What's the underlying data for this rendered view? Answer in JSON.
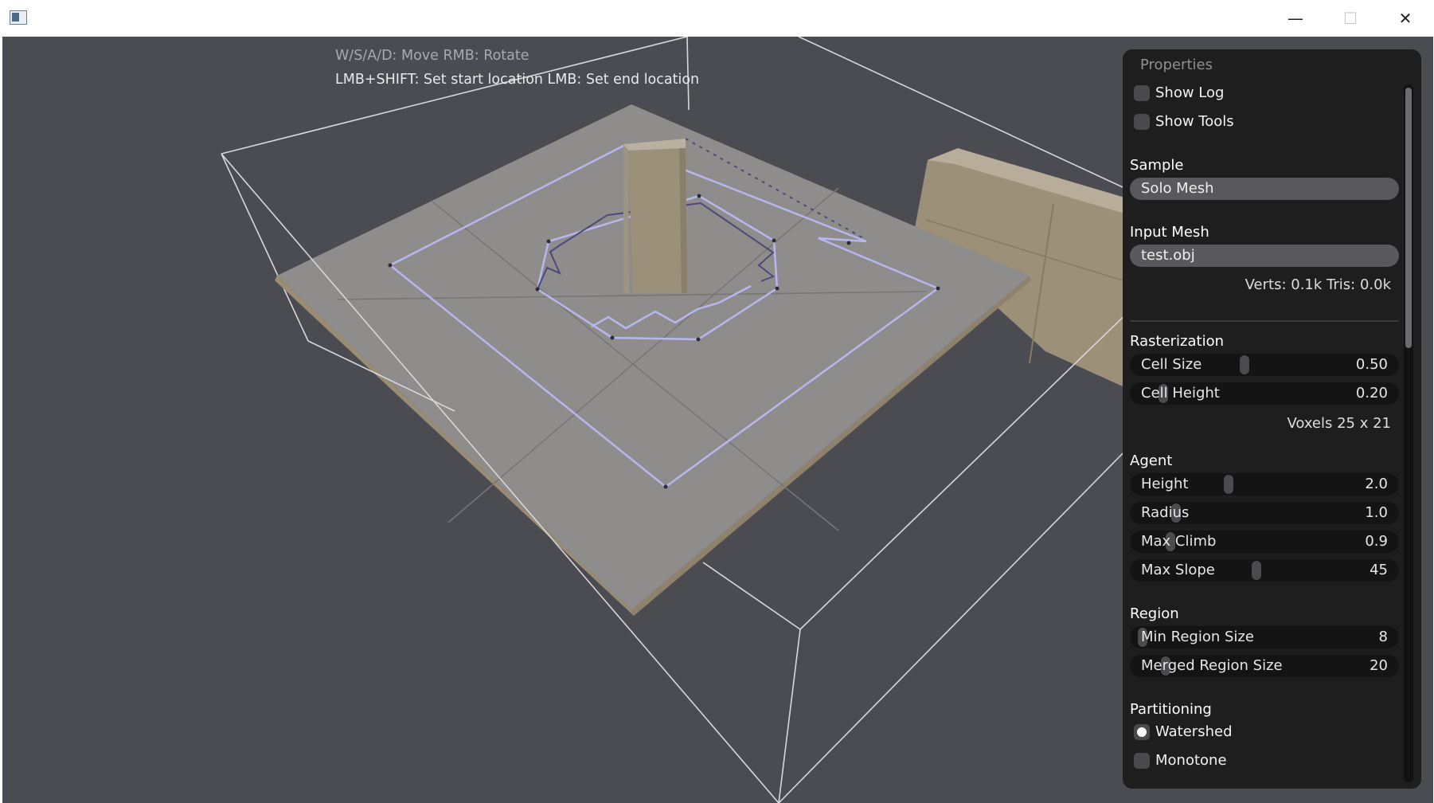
{
  "window": {
    "title": "",
    "buttons": {
      "minimize": "—",
      "maximize": "☐",
      "close": "✕"
    }
  },
  "viewport": {
    "hint_line1": "W/S/A/D: Move  RMB: Rotate",
    "hint_line2": "LMB+SHIFT: Set start location  LMB: Set end location"
  },
  "panel": {
    "title": "Properties",
    "show_log": {
      "label": "Show Log",
      "checked": false
    },
    "show_tools": {
      "label": "Show Tools",
      "checked": false
    },
    "sample": {
      "heading": "Sample",
      "value": "Solo Mesh"
    },
    "input_mesh": {
      "heading": "Input Mesh",
      "value": "test.obj",
      "stats": "Verts: 0.1k  Tris: 0.0k"
    },
    "rasterization": {
      "heading": "Rasterization",
      "cell_size": {
        "label": "Cell Size",
        "value": "0.50",
        "fraction": 0.42
      },
      "cell_height": {
        "label": "Cell Height",
        "value": "0.20",
        "fraction": 0.1
      },
      "voxels": "Voxels  25 x 21"
    },
    "agent": {
      "heading": "Agent",
      "height": {
        "label": "Height",
        "value": "2.0",
        "fraction": 0.36
      },
      "radius": {
        "label": "Radius",
        "value": "1.0",
        "fraction": 0.15
      },
      "max_climb": {
        "label": "Max Climb",
        "value": "0.9",
        "fraction": 0.13
      },
      "max_slope": {
        "label": "Max Slope",
        "value": "45",
        "fraction": 0.47
      }
    },
    "region": {
      "heading": "Region",
      "min_region_size": {
        "label": "Min Region Size",
        "value": "8",
        "fraction": 0.02
      },
      "merged_region_size": {
        "label": "Merged Region Size",
        "value": "20",
        "fraction": 0.11
      }
    },
    "partitioning": {
      "heading": "Partitioning",
      "options": [
        {
          "label": "Watershed",
          "selected": true
        },
        {
          "label": "Monotone",
          "selected": false
        }
      ]
    }
  },
  "colors": {
    "viewport_bg": "#4b4b52",
    "panel_bg": "#1e1e1f",
    "navmesh_outline": "#b8b6ee",
    "geometry": "#a69a86"
  }
}
